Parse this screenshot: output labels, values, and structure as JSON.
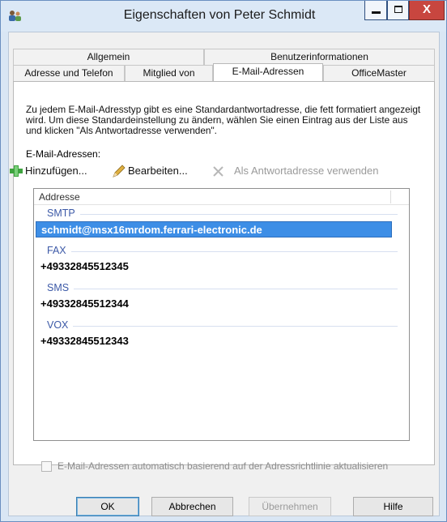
{
  "window": {
    "title": "Eigenschaften von Peter Schmidt",
    "controls": {
      "minimize": "",
      "maximize": "",
      "close": "X"
    }
  },
  "tabs": {
    "row1": [
      "Allgemein",
      "Benutzerinformationen"
    ],
    "row2": [
      "Adresse und Telefon",
      "Mitglied von",
      "E-Mail-Adressen",
      "OfficeMaster"
    ],
    "active": "E-Mail-Adressen"
  },
  "description": "Zu jedem E-Mail-Adresstyp gibt es eine Standardantwortadresse, die fett formatiert angezeigt wird. Um diese Standardeinstellung zu ändern, wählen Sie einen Eintrag aus der Liste aus und klicken \"Als Antwortadresse verwenden\".",
  "email_label": "E-Mail-Adressen:",
  "toolbar": {
    "add": "Hinzufügen...",
    "edit": "Bearbeiten...",
    "set_reply": "Als Antwortadresse verwenden"
  },
  "list": {
    "column_header": "Addresse",
    "groups": [
      {
        "name": "SMTP",
        "items": [
          "schmidt@msx16mrdom.ferrari-electronic.de"
        ]
      },
      {
        "name": "FAX",
        "items": [
          "+49332845512345"
        ]
      },
      {
        "name": "SMS",
        "items": [
          "+49332845512344"
        ]
      },
      {
        "name": "VOX",
        "items": [
          "+49332845512343"
        ]
      }
    ],
    "selected": "schmidt@msx16mrdom.ferrari-electronic.de"
  },
  "checkbox": {
    "label": "E-Mail-Adressen automatisch basierend auf der Adressrichtlinie aktualisieren",
    "checked": false
  },
  "buttons": {
    "ok": "OK",
    "cancel": "Abbrechen",
    "apply": "Übernehmen",
    "help": "Hilfe"
  },
  "colors": {
    "accent": "#3d8ee6",
    "group_text": "#3c59a7",
    "close_button": "#c8463f"
  }
}
